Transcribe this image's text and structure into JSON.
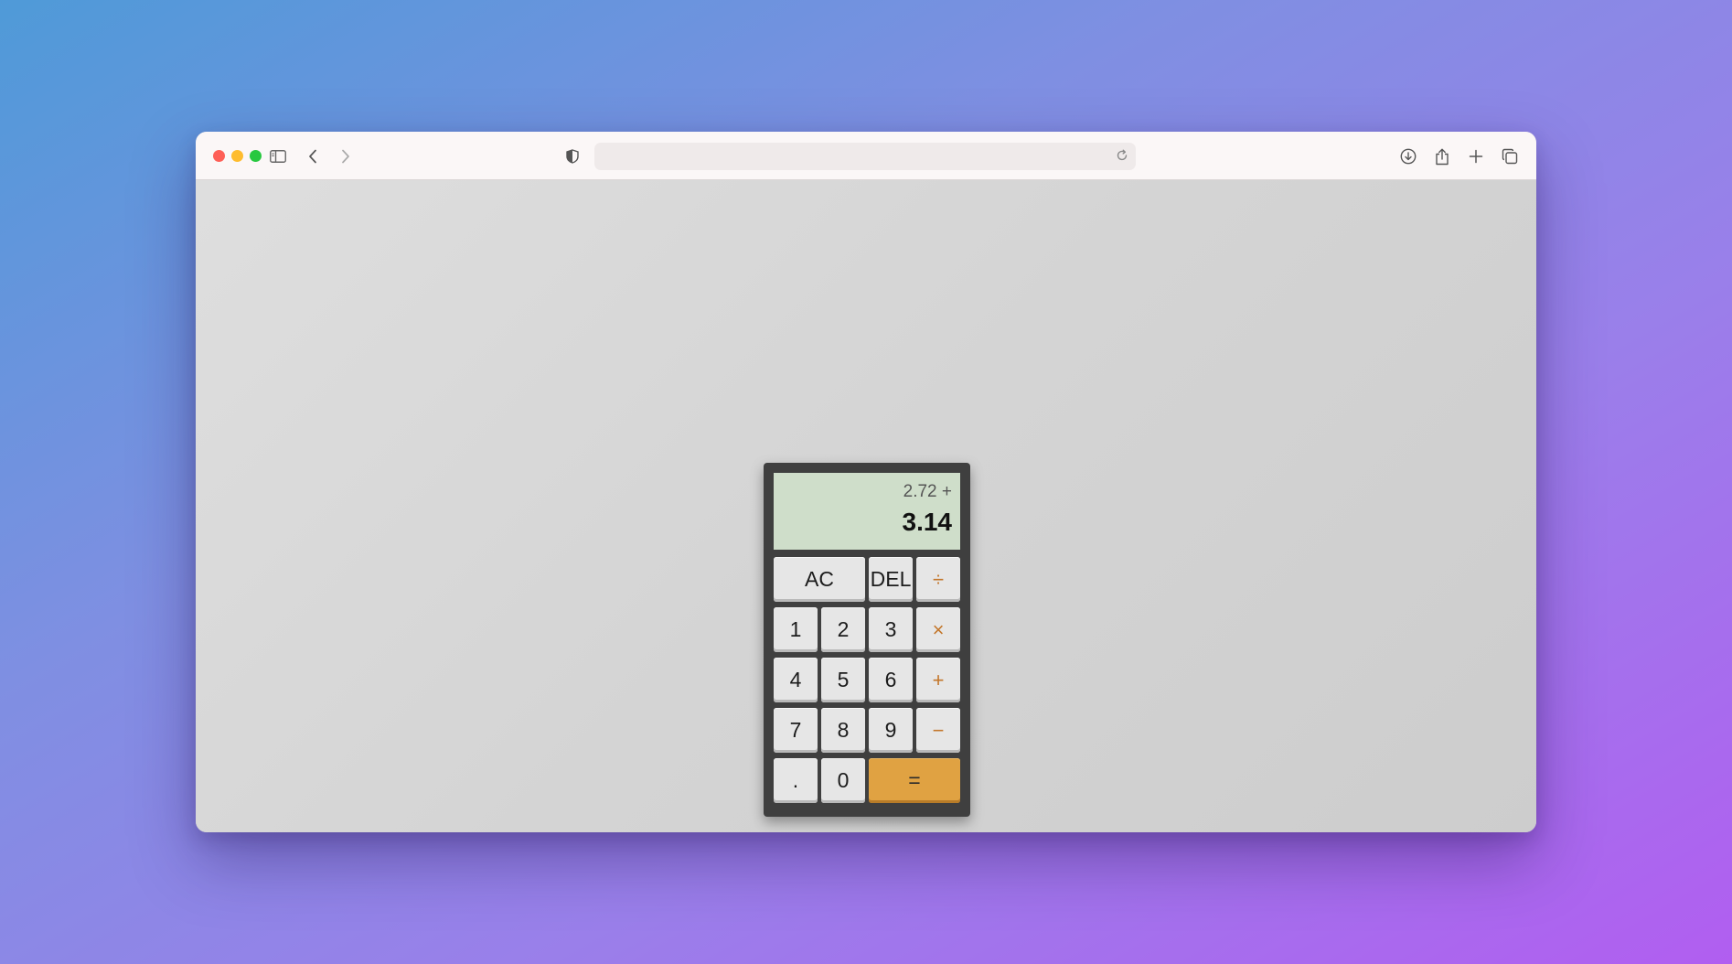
{
  "browser": {
    "toolbar_icons": {
      "sidebar": "sidebar-icon",
      "back": "chevron-left-icon",
      "forward": "chevron-right-icon",
      "privacy": "shield-icon",
      "reload": "reload-icon",
      "downloads": "download-icon",
      "share": "share-icon",
      "new_tab": "plus-icon",
      "tabs": "tabs-overview-icon"
    },
    "url": ""
  },
  "calculator": {
    "display": {
      "previous": "2.72 +",
      "current": "3.14"
    },
    "keys": {
      "ac": "AC",
      "del": "DEL",
      "divide": "÷",
      "multiply": "×",
      "add": "+",
      "subtract": "−",
      "equals": "=",
      "decimal": ".",
      "d0": "0",
      "d1": "1",
      "d2": "2",
      "d3": "3",
      "d4": "4",
      "d5": "5",
      "d6": "6",
      "d7": "7",
      "d8": "8",
      "d9": "9"
    },
    "colors": {
      "display_bg": "#cfdeca",
      "operator": "#c3762a",
      "equals_bg": "#e0a242",
      "body": "#3f3f3f"
    }
  }
}
